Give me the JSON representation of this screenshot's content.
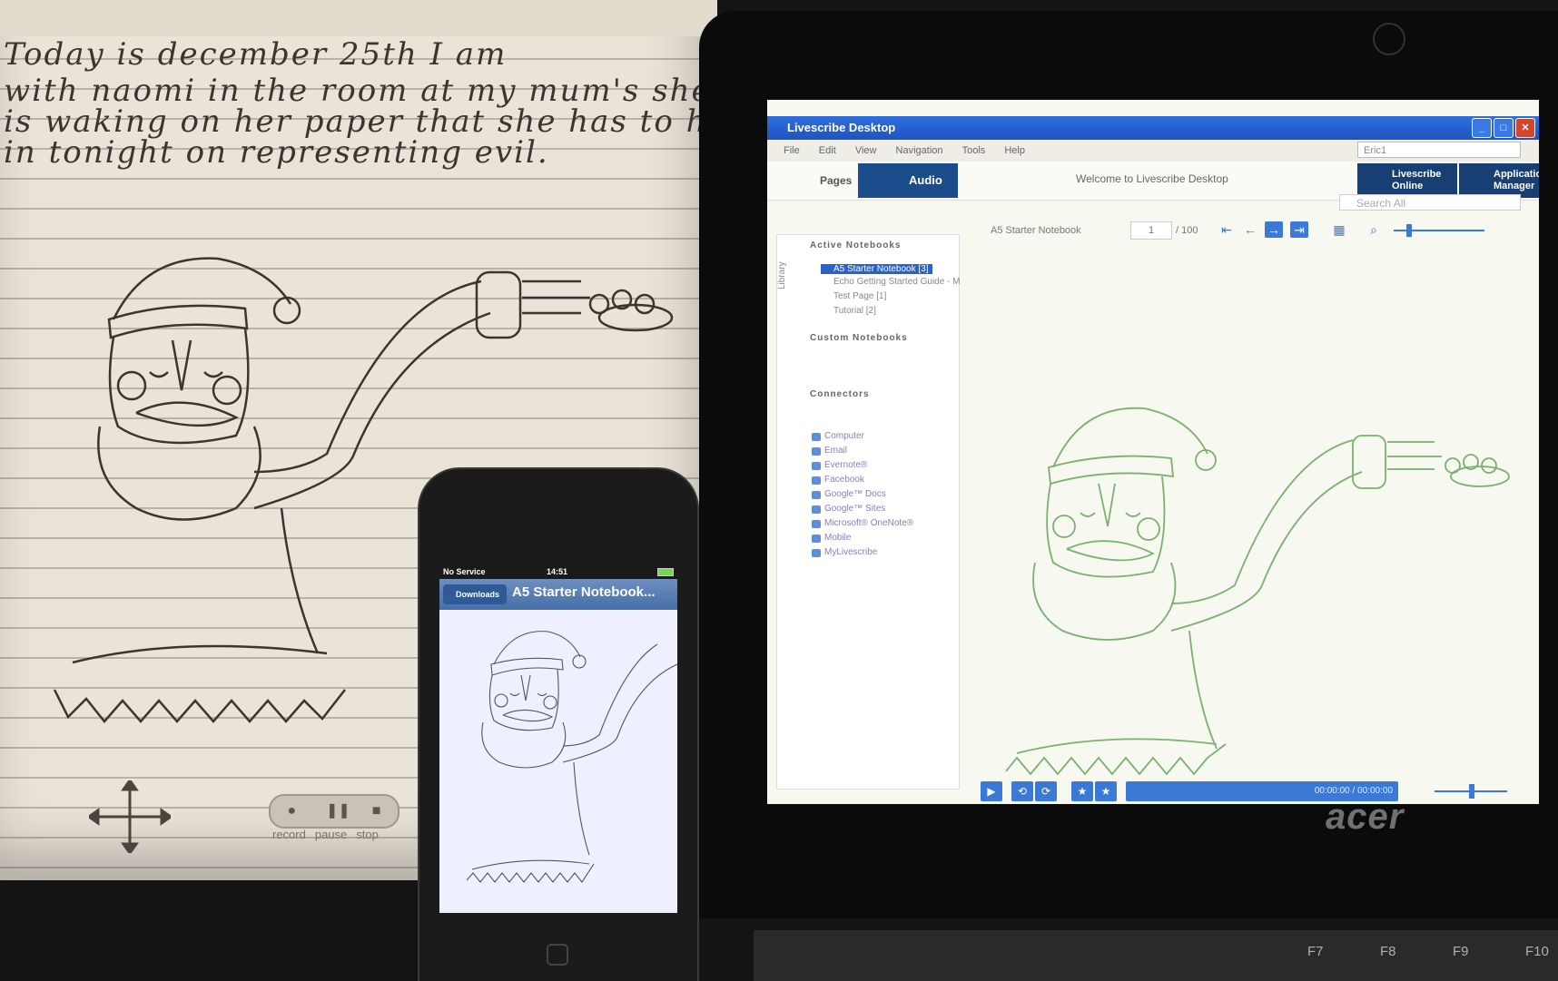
{
  "paper": {
    "handwriting": [
      "Today  is  december  25th  I  am",
      "with  naomi  in  the  room  at  my  mum's  she",
      "is  waking  on  her  paper  that  she  has  to  hand",
      "in  tonight  on  representing  evil."
    ],
    "pen_controls": {
      "record": "record",
      "pause": "pause",
      "stop": "stop"
    }
  },
  "laptop": {
    "brand": "acer",
    "keys": [
      "F7",
      "F8",
      "F9",
      "F10"
    ],
    "app": {
      "title": "Livescribe Desktop",
      "menu": [
        "File",
        "Edit",
        "View",
        "Navigation",
        "Tools",
        "Help"
      ],
      "user": "Eric1",
      "toolbar": {
        "pages": "Pages",
        "audio": "Audio",
        "welcome": "Welcome to Livescribe Desktop",
        "online": "Livescribe Online",
        "app_manager": "Application Manager"
      },
      "search_placeholder": "Search All",
      "library_tab": "Library",
      "sections": {
        "active": "Active Notebooks",
        "custom": "Custom Notebooks",
        "connectors": "Connectors"
      },
      "notebooks": [
        "A5 Starter Notebook [3]",
        "Echo Getting Started Guide - M",
        "Test Page [1]",
        "Tutorial [2]"
      ],
      "connectors": [
        "Computer",
        "Email",
        "Evernote®",
        "Facebook",
        "Google™ Docs",
        "Google™ Sites",
        "Microsoft® OneNote®",
        "Mobile",
        "MyLivescribe"
      ],
      "pagebar": {
        "notebook": "A5 Starter Notebook",
        "page": "1",
        "total": "/ 100"
      },
      "playback": {
        "time": "00:00:00 / 00:00:00"
      }
    }
  },
  "phone": {
    "carrier": "No Service",
    "time": "14:51",
    "back": "Downloads",
    "title": "A5 Starter Notebook..."
  },
  "colors": {
    "pen_ink": "#3b3530",
    "desktop_ink": "#7ab070",
    "selection": "#2a62c8",
    "audio_tab": "#1b4d8c"
  }
}
